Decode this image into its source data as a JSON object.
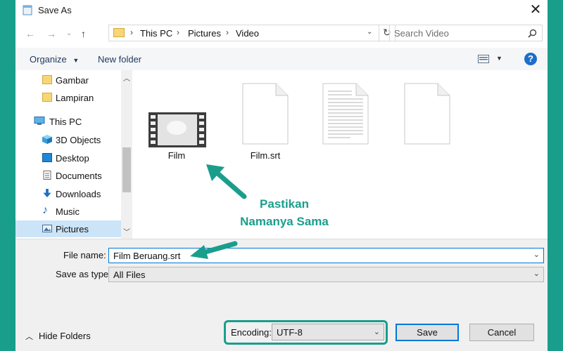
{
  "window": {
    "title": "Save As"
  },
  "address": {
    "parts": [
      "This PC",
      "Pictures",
      "Video"
    ]
  },
  "search": {
    "placeholder": "Search Video"
  },
  "toolbar": {
    "organize": "Organize",
    "new_folder": "New folder",
    "help": "?"
  },
  "sidebar": {
    "items": [
      {
        "label": "Gambar",
        "icon": "folder-icon"
      },
      {
        "label": "Lampiran",
        "icon": "folder-icon"
      },
      {
        "label": "This PC",
        "icon": "computer-icon"
      },
      {
        "label": "3D Objects",
        "icon": "cube-icon"
      },
      {
        "label": "Desktop",
        "icon": "desktop-icon"
      },
      {
        "label": "Documents",
        "icon": "document-icon"
      },
      {
        "label": "Downloads",
        "icon": "download-arrow-icon"
      },
      {
        "label": "Music",
        "icon": "music-note-icon"
      },
      {
        "label": "Pictures",
        "icon": "picture-icon",
        "selected": true
      }
    ]
  },
  "files": [
    {
      "name": "Film",
      "type": "video"
    },
    {
      "name": "Film.srt",
      "type": "blank-document"
    },
    {
      "name": "",
      "type": "text-document"
    },
    {
      "name": "",
      "type": "blank-document"
    }
  ],
  "form": {
    "file_name_label": "File name:",
    "file_name_value": "Film Beruang.srt",
    "save_type_label": "Save as type:",
    "save_type_value": "All Files",
    "encoding_label": "Encoding:",
    "encoding_value": "UTF-8"
  },
  "buttons": {
    "save": "Save",
    "cancel": "Cancel",
    "hide_folders": "Hide Folders"
  },
  "annotation": {
    "line1": "Pastikan",
    "line2": "Namanya Sama"
  },
  "colors": {
    "accent": "#1a9e8c",
    "selection": "#cce4f7",
    "focus": "#0078d7"
  }
}
